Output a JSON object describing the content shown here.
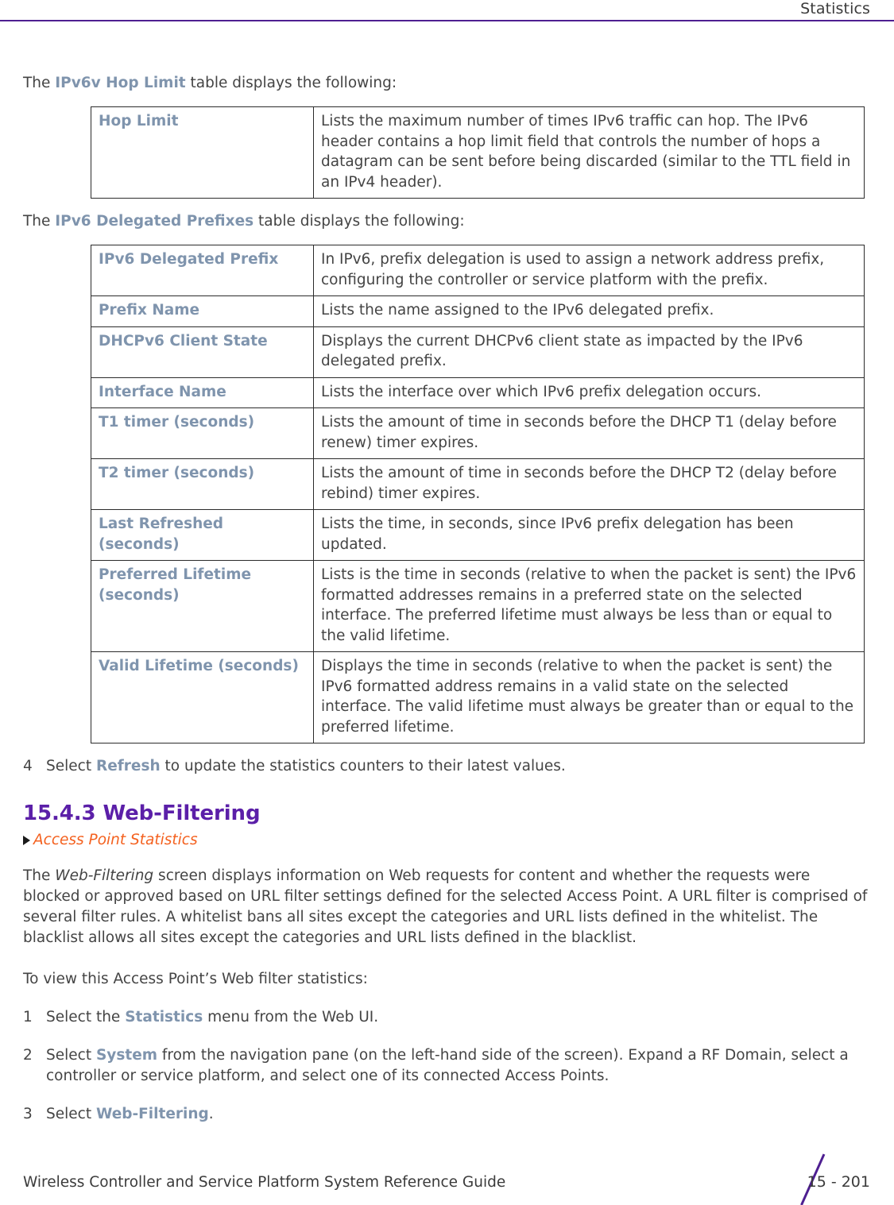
{
  "header": {
    "title": "Statistics",
    "rule_color": "#4e1f91"
  },
  "intro_hop_limit": {
    "prefix": "The ",
    "term": "IPv6v Hop Limit",
    "suffix": " table displays the following:"
  },
  "hop_limit_table": {
    "rows": [
      {
        "label": "Hop Limit",
        "description": "Lists the maximum number of times IPv6 traffic can hop. The IPv6 header contains a hop limit field that controls the number of hops a datagram can be sent before being discarded (similar to the TTL field in an IPv4 header)."
      }
    ]
  },
  "intro_delegated_prefixes": {
    "prefix": "The ",
    "term": "IPv6 Delegated Prefixes",
    "suffix": " table displays the following:"
  },
  "delegated_prefixes_table": {
    "rows": [
      {
        "label": "IPv6 Delegated Prefix",
        "description": "In IPv6, prefix delegation is used to assign a network address prefix, configuring the controller or service platform with the prefix."
      },
      {
        "label": "Prefix Name",
        "description": "Lists the name assigned to the IPv6 delegated prefix."
      },
      {
        "label": "DHCPv6 Client State",
        "description": "Displays the current DHCPv6 client state as impacted by the IPv6 delegated prefix."
      },
      {
        "label": "Interface Name",
        "description": "Lists the interface over which IPv6 prefix delegation occurs."
      },
      {
        "label": "T1 timer (seconds)",
        "description": "Lists the amount of time in seconds before the DHCP T1 (delay before renew) timer expires."
      },
      {
        "label": "T2 timer (seconds)",
        "description": "Lists the amount of time in seconds before the DHCP T2 (delay before rebind) timer expires."
      },
      {
        "label": "Last Refreshed (seconds)",
        "description": "Lists the time, in seconds, since IPv6 prefix delegation has been updated."
      },
      {
        "label": "Preferred Lifetime (seconds)",
        "description": "Lists is the time in seconds (relative to when the packet is sent) the IPv6 formatted addresses remains in a preferred state on the selected interface. The preferred lifetime must always be less than or equal to the valid lifetime."
      },
      {
        "label": "Valid Lifetime (seconds)",
        "description": "Displays the time in seconds (relative to when the packet is sent) the IPv6 formatted address remains in a valid state on the selected interface. The valid lifetime must always be greater than or equal to the preferred lifetime."
      }
    ]
  },
  "step_refresh": {
    "number": "4",
    "prefix": "Select ",
    "term": "Refresh",
    "suffix": " to update the statistics counters to their latest values."
  },
  "section": {
    "heading": "15.4.3 Web-Filtering",
    "cross_reference": "Access Point Statistics",
    "heading_color": "#5b1fa8",
    "xref_color": "#f4611f"
  },
  "body_paragraph": {
    "part1": "The ",
    "emphasis": "Web-Filtering",
    "part2": " screen displays information on Web requests for content and whether the requests were blocked or approved based on URL filter settings defined for the selected Access Point. A URL filter is comprised of several filter rules. A whitelist bans all sites except the categories and URL lists defined in the whitelist. The blacklist allows all sites except the categories and URL lists defined in the blacklist."
  },
  "intro_steps": "To view this Access Point’s Web filter statistics:",
  "steps": [
    {
      "number": "1",
      "prefix": "Select the ",
      "term": "Statistics",
      "suffix": " menu from the Web UI."
    },
    {
      "number": "2",
      "prefix": "Select ",
      "term": "System",
      "suffix": " from the navigation pane (on the left-hand side of the screen). Expand a RF Domain, select a controller or service platform, and select one of its connected Access Points."
    },
    {
      "number": "3",
      "prefix": "Select ",
      "term": "Web-Filtering",
      "suffix": "."
    }
  ],
  "footer": {
    "guide_title": "Wireless Controller and Service Platform System Reference Guide",
    "page_number": "15 - 201"
  }
}
